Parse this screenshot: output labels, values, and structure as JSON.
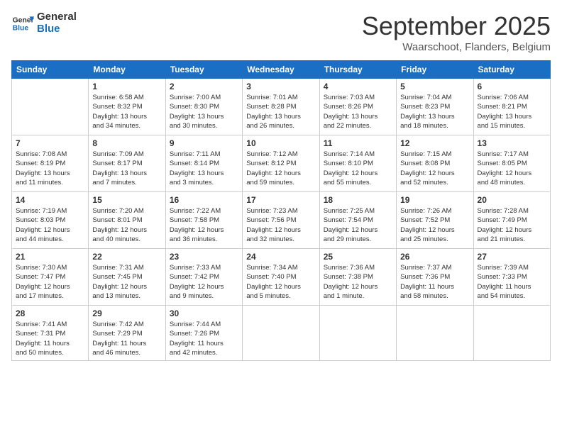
{
  "header": {
    "logo_line1": "General",
    "logo_line2": "Blue",
    "month": "September 2025",
    "location": "Waarschoot, Flanders, Belgium"
  },
  "weekdays": [
    "Sunday",
    "Monday",
    "Tuesday",
    "Wednesday",
    "Thursday",
    "Friday",
    "Saturday"
  ],
  "weeks": [
    [
      {
        "day": "",
        "info": ""
      },
      {
        "day": "1",
        "info": "Sunrise: 6:58 AM\nSunset: 8:32 PM\nDaylight: 13 hours\nand 34 minutes."
      },
      {
        "day": "2",
        "info": "Sunrise: 7:00 AM\nSunset: 8:30 PM\nDaylight: 13 hours\nand 30 minutes."
      },
      {
        "day": "3",
        "info": "Sunrise: 7:01 AM\nSunset: 8:28 PM\nDaylight: 13 hours\nand 26 minutes."
      },
      {
        "day": "4",
        "info": "Sunrise: 7:03 AM\nSunset: 8:26 PM\nDaylight: 13 hours\nand 22 minutes."
      },
      {
        "day": "5",
        "info": "Sunrise: 7:04 AM\nSunset: 8:23 PM\nDaylight: 13 hours\nand 18 minutes."
      },
      {
        "day": "6",
        "info": "Sunrise: 7:06 AM\nSunset: 8:21 PM\nDaylight: 13 hours\nand 15 minutes."
      }
    ],
    [
      {
        "day": "7",
        "info": "Sunrise: 7:08 AM\nSunset: 8:19 PM\nDaylight: 13 hours\nand 11 minutes."
      },
      {
        "day": "8",
        "info": "Sunrise: 7:09 AM\nSunset: 8:17 PM\nDaylight: 13 hours\nand 7 minutes."
      },
      {
        "day": "9",
        "info": "Sunrise: 7:11 AM\nSunset: 8:14 PM\nDaylight: 13 hours\nand 3 minutes."
      },
      {
        "day": "10",
        "info": "Sunrise: 7:12 AM\nSunset: 8:12 PM\nDaylight: 12 hours\nand 59 minutes."
      },
      {
        "day": "11",
        "info": "Sunrise: 7:14 AM\nSunset: 8:10 PM\nDaylight: 12 hours\nand 55 minutes."
      },
      {
        "day": "12",
        "info": "Sunrise: 7:15 AM\nSunset: 8:08 PM\nDaylight: 12 hours\nand 52 minutes."
      },
      {
        "day": "13",
        "info": "Sunrise: 7:17 AM\nSunset: 8:05 PM\nDaylight: 12 hours\nand 48 minutes."
      }
    ],
    [
      {
        "day": "14",
        "info": "Sunrise: 7:19 AM\nSunset: 8:03 PM\nDaylight: 12 hours\nand 44 minutes."
      },
      {
        "day": "15",
        "info": "Sunrise: 7:20 AM\nSunset: 8:01 PM\nDaylight: 12 hours\nand 40 minutes."
      },
      {
        "day": "16",
        "info": "Sunrise: 7:22 AM\nSunset: 7:58 PM\nDaylight: 12 hours\nand 36 minutes."
      },
      {
        "day": "17",
        "info": "Sunrise: 7:23 AM\nSunset: 7:56 PM\nDaylight: 12 hours\nand 32 minutes."
      },
      {
        "day": "18",
        "info": "Sunrise: 7:25 AM\nSunset: 7:54 PM\nDaylight: 12 hours\nand 29 minutes."
      },
      {
        "day": "19",
        "info": "Sunrise: 7:26 AM\nSunset: 7:52 PM\nDaylight: 12 hours\nand 25 minutes."
      },
      {
        "day": "20",
        "info": "Sunrise: 7:28 AM\nSunset: 7:49 PM\nDaylight: 12 hours\nand 21 minutes."
      }
    ],
    [
      {
        "day": "21",
        "info": "Sunrise: 7:30 AM\nSunset: 7:47 PM\nDaylight: 12 hours\nand 17 minutes."
      },
      {
        "day": "22",
        "info": "Sunrise: 7:31 AM\nSunset: 7:45 PM\nDaylight: 12 hours\nand 13 minutes."
      },
      {
        "day": "23",
        "info": "Sunrise: 7:33 AM\nSunset: 7:42 PM\nDaylight: 12 hours\nand 9 minutes."
      },
      {
        "day": "24",
        "info": "Sunrise: 7:34 AM\nSunset: 7:40 PM\nDaylight: 12 hours\nand 5 minutes."
      },
      {
        "day": "25",
        "info": "Sunrise: 7:36 AM\nSunset: 7:38 PM\nDaylight: 12 hours\nand 1 minute."
      },
      {
        "day": "26",
        "info": "Sunrise: 7:37 AM\nSunset: 7:36 PM\nDaylight: 11 hours\nand 58 minutes."
      },
      {
        "day": "27",
        "info": "Sunrise: 7:39 AM\nSunset: 7:33 PM\nDaylight: 11 hours\nand 54 minutes."
      }
    ],
    [
      {
        "day": "28",
        "info": "Sunrise: 7:41 AM\nSunset: 7:31 PM\nDaylight: 11 hours\nand 50 minutes."
      },
      {
        "day": "29",
        "info": "Sunrise: 7:42 AM\nSunset: 7:29 PM\nDaylight: 11 hours\nand 46 minutes."
      },
      {
        "day": "30",
        "info": "Sunrise: 7:44 AM\nSunset: 7:26 PM\nDaylight: 11 hours\nand 42 minutes."
      },
      {
        "day": "",
        "info": ""
      },
      {
        "day": "",
        "info": ""
      },
      {
        "day": "",
        "info": ""
      },
      {
        "day": "",
        "info": ""
      }
    ]
  ]
}
